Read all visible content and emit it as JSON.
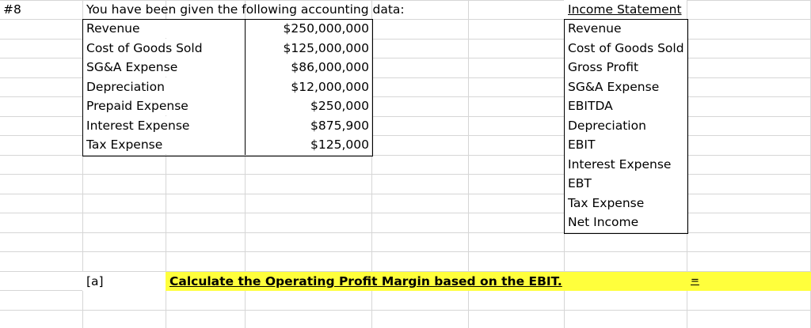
{
  "problem_number": "#8",
  "intro_text": "You have been given the following accounting data:",
  "accounting_data": [
    {
      "label": "Revenue",
      "value": "$250,000,000"
    },
    {
      "label": "Cost of Goods Sold",
      "value": "$125,000,000"
    },
    {
      "label": "SG&A Expense",
      "value": "$86,000,000"
    },
    {
      "label": "Depreciation",
      "value": "$12,000,000"
    },
    {
      "label": "Prepaid Expense",
      "value": "$250,000"
    },
    {
      "label": "Interest Expense",
      "value": "$875,900"
    },
    {
      "label": "Tax Expense",
      "value": "$125,000"
    }
  ],
  "income_statement": {
    "title": "Income Statement",
    "lines": [
      "Revenue",
      "Cost of Goods Sold",
      "Gross Profit",
      "SG&A Expense",
      "EBITDA",
      "Depreciation",
      "EBIT",
      "Interest Expense",
      "EBT",
      "Tax Expense",
      "Net Income"
    ]
  },
  "question": {
    "label": "[a]",
    "text": "Calculate the Operating Profit Margin based on the EBIT.",
    "answer_placeholder": "="
  },
  "colors": {
    "highlight": "#ffff3c",
    "gridline": "#d6d6d6"
  }
}
